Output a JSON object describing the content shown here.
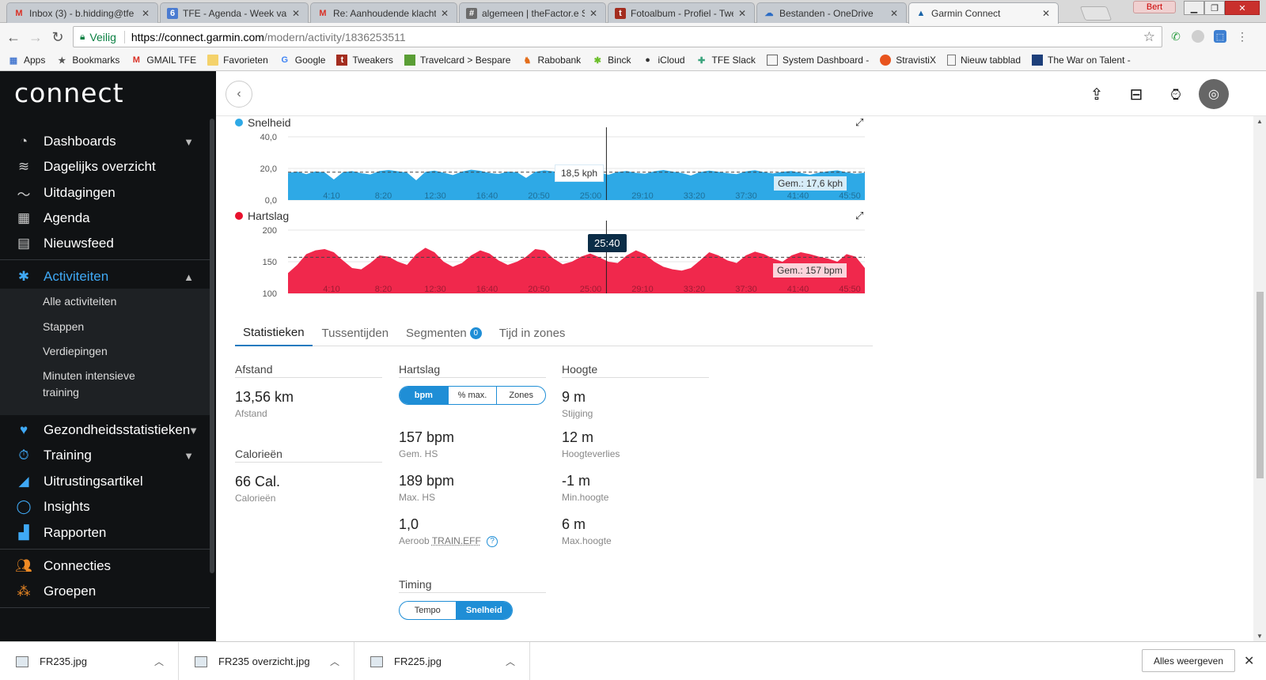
{
  "browser": {
    "tabs": [
      {
        "title": "Inbox (3) - b.hidding@tfe",
        "icon": "gmail-icon"
      },
      {
        "title": "TFE - Agenda - Week van",
        "icon": "calendar-icon"
      },
      {
        "title": "Re: Aanhoudende klachte",
        "icon": "gmail-icon"
      },
      {
        "title": "algemeen | theFactor.e S",
        "icon": "slack-icon"
      },
      {
        "title": "Fotoalbum - Profiel - Twe",
        "icon": "tweakers-icon"
      },
      {
        "title": "Bestanden - OneDrive",
        "icon": "onedrive-icon"
      },
      {
        "title": "Garmin Connect",
        "icon": "garmin-icon",
        "active": true
      }
    ],
    "profile_name": "Bert",
    "address": {
      "secure_label": "Veilig",
      "host": "https://connect.garmin.com",
      "path": "/modern/activity/1836253511"
    },
    "bookmarks": [
      "Apps",
      "Bookmarks",
      "GMAIL TFE",
      "Favorieten",
      "Google",
      "Tweakers",
      "Travelcard > Bespare",
      "Rabobank",
      "Binck",
      "iCloud",
      "TFE Slack",
      "System Dashboard -",
      "StravistiX",
      "Nieuw tabblad",
      "The War on Talent -"
    ]
  },
  "sidebar": {
    "logo": "connect",
    "items": [
      {
        "label": "Dashboards",
        "icon": "gauge-icon",
        "chevron": "down"
      },
      {
        "label": "Dagelijks overzicht",
        "icon": "layers-icon"
      },
      {
        "label": "Uitdagingen",
        "icon": "challenge-icon"
      },
      {
        "label": "Agenda",
        "icon": "calendar-icon"
      },
      {
        "label": "Nieuwsfeed",
        "icon": "newsfeed-icon"
      },
      {
        "label": "Activiteiten",
        "icon": "running-person-icon",
        "chevron": "up",
        "active": true
      },
      {
        "label": "Gezondheidsstatistieken",
        "icon": "heart-icon",
        "chevron": "down"
      },
      {
        "label": "Training",
        "icon": "stopwatch-icon",
        "chevron": "down"
      },
      {
        "label": "Uitrustingsartikel",
        "icon": "shoe-icon"
      },
      {
        "label": "Insights",
        "icon": "lightbulb-icon"
      },
      {
        "label": "Rapporten",
        "icon": "bar-chart-icon"
      },
      {
        "label": "Connecties",
        "icon": "connections-icon"
      },
      {
        "label": "Groepen",
        "icon": "groups-icon"
      }
    ],
    "sub_items": [
      "Alle activiteiten",
      "Stappen",
      "Verdiepingen",
      "Minuten intensieve training"
    ]
  },
  "header": {
    "back": "back-icon",
    "icons": [
      "upload-icon",
      "inbox-icon",
      "watch-icon",
      "avatar"
    ]
  },
  "charts": {
    "speed": {
      "legend": "Snelheid",
      "color": "#2ea9e6",
      "tooltip": "18,5 kph",
      "avg_label": "Gem.: 17,6 kph"
    },
    "heart": {
      "legend": "Hartslag",
      "color": "#f0284c",
      "time_badge": "25:40",
      "avg_label": "Gem.: 157 bpm"
    }
  },
  "chart_data": [
    {
      "type": "area",
      "title": "Snelheid",
      "ylim": [
        0,
        40
      ],
      "y_ticks": [
        "40,0",
        "20,0",
        "0,0"
      ],
      "x_ticks": [
        "4:10",
        "8:20",
        "12:30",
        "16:40",
        "20:50",
        "25:00",
        "29:10",
        "33:20",
        "37:30",
        "41:40",
        "45:50"
      ],
      "average": 17.6,
      "unit": "kph",
      "cursor": {
        "x": "25:40",
        "y": 18.5
      },
      "series": [
        {
          "name": "Snelheid",
          "values": [
            17.2,
            18.0,
            16.4,
            18.1,
            17.5,
            13.0,
            17.6,
            18.3,
            17.0,
            16.2,
            18.4,
            19.0,
            18.2,
            17.4,
            12.5,
            17.8,
            18.6,
            17.3,
            15.8,
            18.0,
            19.2,
            18.5,
            17.1,
            16.5,
            18.0,
            17.6,
            14.0,
            17.9,
            18.8,
            18.1,
            17.0,
            16.9,
            18.3,
            18.7,
            17.4,
            16.0,
            17.8,
            18.4,
            17.2,
            16.6,
            18.2,
            19.0,
            18.0,
            17.1,
            15.5,
            17.7,
            18.6,
            17.9,
            17.0,
            16.4,
            18.1,
            18.9,
            17.6,
            16.8,
            17.9,
            18.4,
            17.2,
            16.0,
            17.4,
            18.2,
            18.8,
            17.5,
            16.6,
            17.3
          ]
        }
      ]
    },
    {
      "type": "area",
      "title": "Hartslag",
      "ylim": [
        100,
        200
      ],
      "y_ticks": [
        "200",
        "150",
        "100"
      ],
      "x_ticks": [
        "4:10",
        "8:20",
        "12:30",
        "16:40",
        "20:50",
        "25:00",
        "29:10",
        "33:20",
        "37:30",
        "41:40",
        "45:50"
      ],
      "average": 157,
      "unit": "bpm",
      "cursor": {
        "x": "25:40"
      },
      "series": [
        {
          "name": "Hartslag",
          "values": [
            132,
            145,
            162,
            168,
            170,
            165,
            152,
            140,
            138,
            148,
            160,
            158,
            150,
            145,
            162,
            172,
            165,
            150,
            142,
            148,
            160,
            168,
            163,
            152,
            145,
            150,
            158,
            170,
            168,
            155,
            146,
            150,
            158,
            163,
            157,
            150,
            148,
            160,
            168,
            162,
            150,
            142,
            138,
            136,
            140,
            152,
            165,
            160,
            152,
            148,
            160,
            166,
            162,
            155,
            150,
            160,
            165,
            162,
            158,
            155,
            150,
            162,
            158,
            140
          ]
        }
      ]
    }
  ],
  "stats": {
    "tabs": [
      "Statistieken",
      "Tussentijden",
      "Segmenten",
      "Tijd in zones"
    ],
    "segment_badge": "0",
    "afstand": {
      "head": "Afstand",
      "value": "13,56 km",
      "label": "Afstand"
    },
    "calorieen": {
      "head": "Calorieën",
      "value": "66 Cal.",
      "label": "Calorieën"
    },
    "hartslag": {
      "head": "Hartslag",
      "toggle": [
        "bpm",
        "% max.",
        "Zones"
      ],
      "gem": {
        "value": "157 bpm",
        "label": "Gem. HS"
      },
      "max": {
        "value": "189 bpm",
        "label": "Max. HS"
      },
      "te": {
        "value": "1,0",
        "label_prefix": "Aeroob",
        "label_link": "TRAIN.EFF"
      }
    },
    "timing": {
      "head": "Timing",
      "toggle": [
        "Tempo",
        "Snelheid"
      ]
    },
    "hoogte": {
      "head": "Hoogte",
      "stijging": {
        "value": "9 m",
        "label": "Stijging"
      },
      "verlies": {
        "value": "12 m",
        "label": "Hoogteverlies"
      },
      "min": {
        "value": "-1 m",
        "label": "Min.hoogte"
      },
      "max": {
        "value": "6 m",
        "label": "Max.hoogte"
      }
    }
  },
  "downloads": {
    "files": [
      "FR235.jpg",
      "FR235 overzicht.jpg",
      "FR225.jpg"
    ],
    "show_all": "Alles weergeven"
  }
}
